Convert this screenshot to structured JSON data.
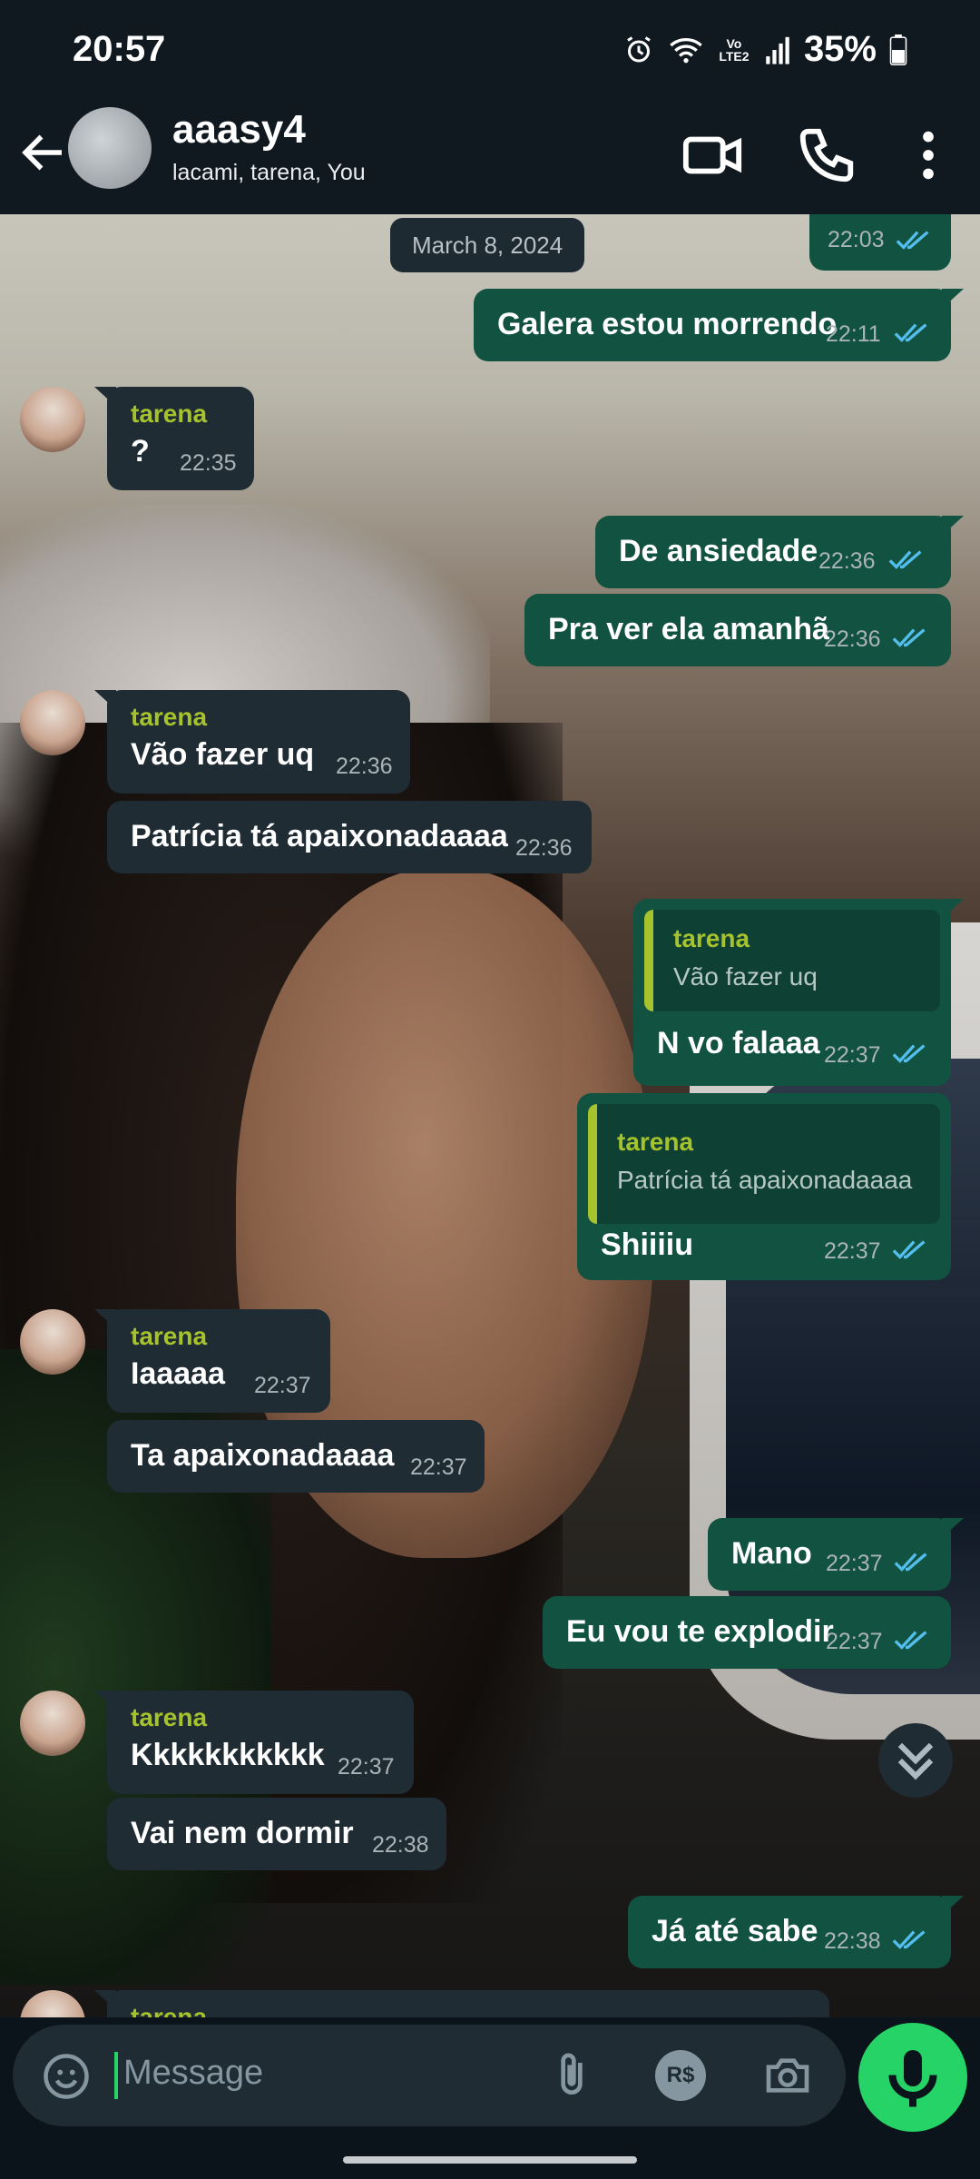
{
  "status": {
    "time": "20:57",
    "network": "Vo LTE2",
    "battery": "35%"
  },
  "header": {
    "title": "aaasy4",
    "subtitle": "lacami, tarena, You"
  },
  "date_chip": "March 8, 2024",
  "messages": [
    {
      "time": "22:03"
    },
    {
      "text": "Galera estou morrendo",
      "time": "22:11"
    },
    {
      "sender": "tarena",
      "text": "?",
      "time": "22:35"
    },
    {
      "text": "De ansiedade",
      "time": "22:36"
    },
    {
      "text": "Pra ver ela amanhã",
      "time": "22:36"
    },
    {
      "sender": "tarena",
      "text": "Vão fazer uq",
      "time": "22:36"
    },
    {
      "text": "Patrícia tá apaixonadaaaa",
      "time": "22:36"
    },
    {
      "quote_name": "tarena",
      "quote_text": "Vão fazer uq",
      "text": "N vo falaaa",
      "time": "22:37"
    },
    {
      "quote_name": "tarena",
      "quote_text": "Patrícia tá apaixonadaaaa",
      "text": "Shiiiiu",
      "time": "22:37"
    },
    {
      "sender": "tarena",
      "text": "Iaaaaa",
      "time": "22:37"
    },
    {
      "text": "Ta apaixonadaaaa",
      "time": "22:37"
    },
    {
      "text": "Mano",
      "time": "22:37"
    },
    {
      "text": "Eu vou te explodir",
      "time": "22:37"
    },
    {
      "sender": "tarena",
      "text": "Kkkkkkkkkkk",
      "time": "22:37"
    },
    {
      "text": "Vai nem dormir",
      "time": "22:38"
    },
    {
      "text": "Já até sabe",
      "time": "22:38"
    },
    {
      "sender": "tarena"
    }
  ],
  "composer": {
    "placeholder": "Message",
    "currency_label": "R$"
  },
  "colors": {
    "outgoing": "#115240",
    "incoming": "#1f2c33",
    "sender_name": "#a6c32e",
    "read_ticks": "#53bdeb",
    "mic": "#25d366"
  },
  "icons": [
    "back-arrow-icon",
    "video-call-icon",
    "voice-call-icon",
    "more-options-icon",
    "emoji-icon",
    "attach-icon",
    "camera-icon",
    "mic-icon",
    "scroll-down-icon",
    "alarm-icon",
    "wifi-icon",
    "signal-icon",
    "battery-icon"
  ]
}
